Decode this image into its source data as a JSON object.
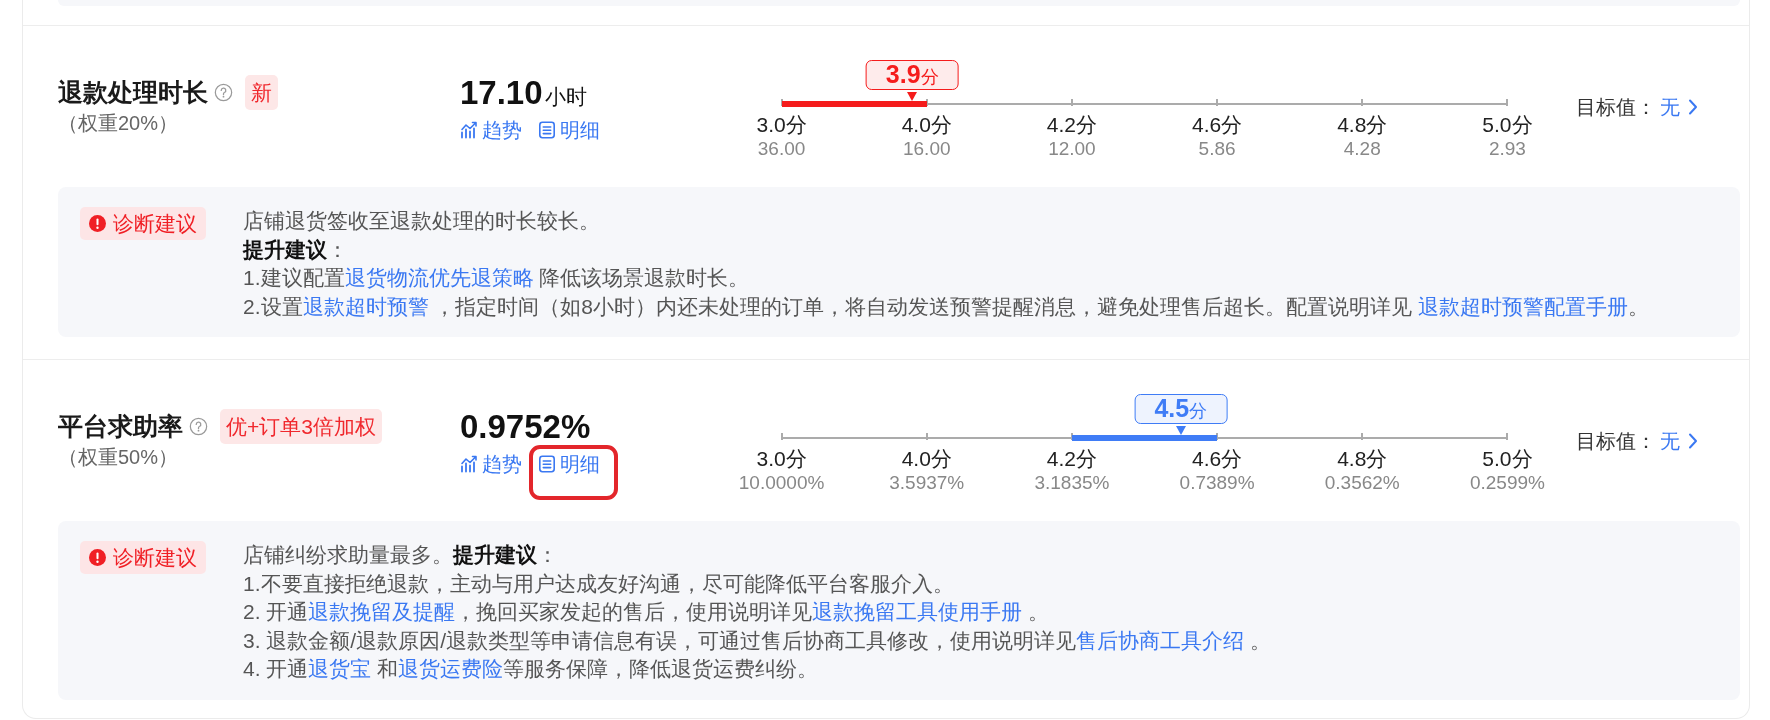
{
  "metrics": [
    {
      "title": "退款处理时长",
      "badge": "新",
      "weight": "（权重20%）",
      "value": "17.10",
      "unit": "小时",
      "links": [
        {
          "kind": "trend",
          "label": "趋势",
          "highlighted": false
        },
        {
          "kind": "detail",
          "label": "明细",
          "highlighted": false
        }
      ],
      "scale": {
        "ticks": [
          {
            "label": "3.0分",
            "value": "36.00"
          },
          {
            "label": "4.0分",
            "value": "16.00"
          },
          {
            "label": "4.2分",
            "value": "12.00"
          },
          {
            "label": "4.6分",
            "value": "5.86"
          },
          {
            "label": "4.8分",
            "value": "4.28"
          },
          {
            "label": "5.0分",
            "value": "2.93"
          }
        ],
        "score": {
          "value": "3.9",
          "unit": "分",
          "level": 0.18,
          "color": "#f51c1c"
        }
      },
      "target": {
        "label": "目标值：",
        "value": "无"
      },
      "diagnosis": {
        "tag": "诊断建议",
        "lines": [
          {
            "segments": [
              {
                "kind": "text",
                "text": "店铺退货签收至退款处理的时长较长。"
              }
            ]
          },
          {
            "segments": [
              {
                "kind": "text",
                "text": "**提升建议**："
              }
            ]
          },
          {
            "segments": [
              {
                "kind": "text",
                "text": "1.建议配置"
              },
              {
                "kind": "link",
                "text": "退货物流优先退策略"
              },
              {
                "kind": "text",
                "text": " 降低该场景退款时长。"
              }
            ]
          },
          {
            "segments": [
              {
                "kind": "text",
                "text": "2.设置"
              },
              {
                "kind": "link",
                "text": "退款超时预警"
              },
              {
                "kind": "text",
                "text": " ，指定时间（如8小时）内还未处理的订单，将自动发送预警提醒消息，避免处理售后超长。配置说明详见 "
              },
              {
                "kind": "link",
                "text": "退款超时预警配置手册"
              },
              {
                "kind": "text",
                "text": "。"
              }
            ]
          }
        ]
      }
    },
    {
      "title": "平台求助率",
      "badge": "优+订单3倍加权",
      "weight": "（权重50%）",
      "value": "0.9752%",
      "links": [
        {
          "kind": "trend",
          "label": "趋势",
          "highlighted": false
        },
        {
          "kind": "detail",
          "label": "明细",
          "highlighted": true
        }
      ],
      "scale": {
        "ticks": [
          {
            "label": "3.0分",
            "value": "10.0000%"
          },
          {
            "label": "4.0分",
            "value": "3.5937%"
          },
          {
            "label": "4.2分",
            "value": "3.1835%"
          },
          {
            "label": "4.6分",
            "value": "0.7389%"
          },
          {
            "label": "4.8分",
            "value": "0.3562%"
          },
          {
            "label": "5.0分",
            "value": "0.2599%"
          }
        ],
        "score": {
          "value": "4.5",
          "unit": "分",
          "level": 0.55,
          "color": "#3f7cf6"
        }
      },
      "target": {
        "label": "目标值：",
        "value": "无"
      },
      "diagnosis": {
        "tag": "诊断建议",
        "lines": [
          {
            "segments": [
              {
                "kind": "text",
                "text": "店铺纠纷求助量最多。**提升建议**："
              }
            ]
          },
          {
            "segments": [
              {
                "kind": "text",
                "text": "1.不要直接拒绝退款，主动与用户达成友好沟通，尽可能降低平台客服介入。"
              }
            ]
          },
          {
            "segments": [
              {
                "kind": "text",
                "text": "2. 开通"
              },
              {
                "kind": "link",
                "text": "退款挽留及提醒"
              },
              {
                "kind": "text",
                "text": "，挽回买家发起的售后，使用说明详见"
              },
              {
                "kind": "link",
                "text": "退款挽留工具使用手册"
              },
              {
                "kind": "text",
                "text": " 。"
              }
            ]
          },
          {
            "segments": [
              {
                "kind": "text",
                "text": "3. 退款金额/退款原因/退款类型等申请信息有误，可通过售后协商工具修改，使用说明详见"
              },
              {
                "kind": "link",
                "text": "售后协商工具介绍"
              },
              {
                "kind": "text",
                "text": " 。"
              }
            ]
          },
          {
            "segments": [
              {
                "kind": "text",
                "text": "4. 开通"
              },
              {
                "kind": "link",
                "text": "退货宝"
              },
              {
                "kind": "text",
                "text": " 和"
              },
              {
                "kind": "link",
                "text": "退货运费险"
              },
              {
                "kind": "text",
                "text": "等服务保障，降低退货运费纠纷。"
              }
            ]
          }
        ]
      }
    }
  ]
}
